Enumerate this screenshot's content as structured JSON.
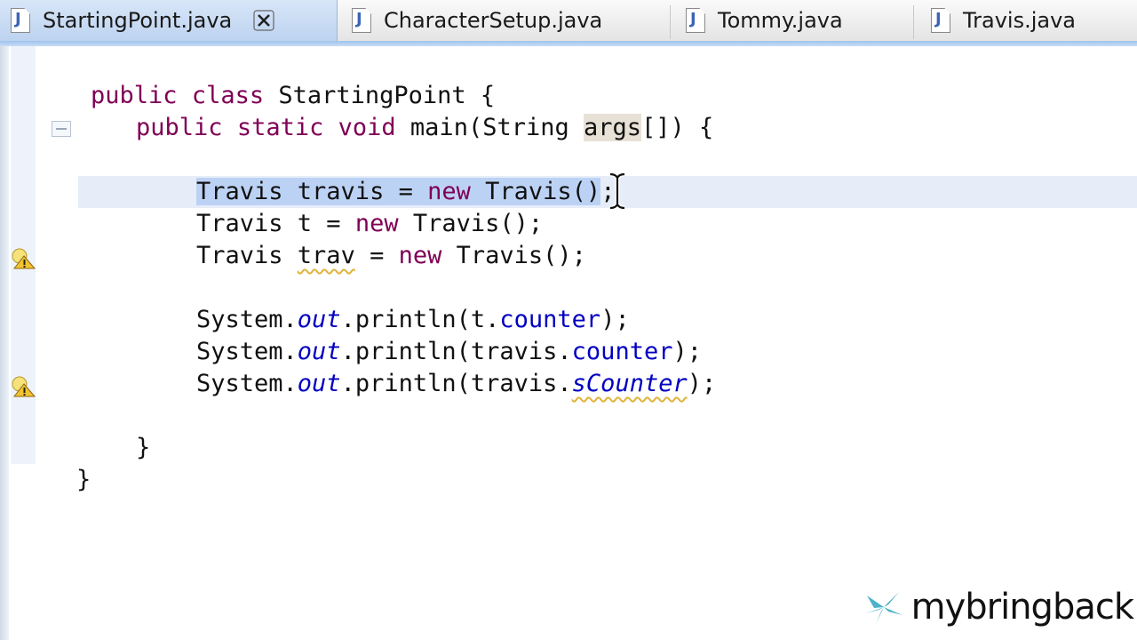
{
  "tabs": [
    {
      "label": "StartingPoint.java",
      "active": true
    },
    {
      "label": "CharacterSetup.java",
      "active": false
    },
    {
      "label": "Tommy.java",
      "active": false
    },
    {
      "label": "Travis.java",
      "active": false
    }
  ],
  "code": {
    "line1": {
      "kw1": "public",
      "kw2": "class",
      "rest": "StartingPoint {"
    },
    "line2": {
      "kw1": "public",
      "kw2": "static",
      "kw3": "void",
      "mid": "main(String ",
      "param": "args",
      "end": "[]) {"
    },
    "line3": {
      "t1": "Travis travis = ",
      "kw": "new",
      "t2": " Travis()",
      "end": ";"
    },
    "line4": {
      "t1": "Travis t = ",
      "kw": "new",
      "t2": " Travis();"
    },
    "line5": {
      "t1": "Travis ",
      "var": "trav",
      "t2": " = ",
      "kw": "new",
      "t3": " Travis();"
    },
    "line6": {
      "t1": "System.",
      "out": "out",
      "t2": ".println(t.",
      "field": "counter",
      "end": ");"
    },
    "line7": {
      "t1": "System.",
      "out": "out",
      "t2": ".println(travis.",
      "field": "counter",
      "end": ");"
    },
    "line8": {
      "t1": "System.",
      "out": "out",
      "t2": ".println(travis.",
      "field": "sCounter",
      "end": ");"
    },
    "line9": "}",
    "line10": "}"
  },
  "watermark": {
    "text": "mybringback"
  },
  "colors": {
    "keyword": "#7f0055",
    "field": "#0000c0",
    "selection": "#bcd2f4",
    "warning": "#e1b33a"
  },
  "icons": {
    "tab_file": "java-file-icon",
    "close": "close-icon",
    "warning": "warning-icon",
    "fold": "fold-collapse-icon"
  }
}
